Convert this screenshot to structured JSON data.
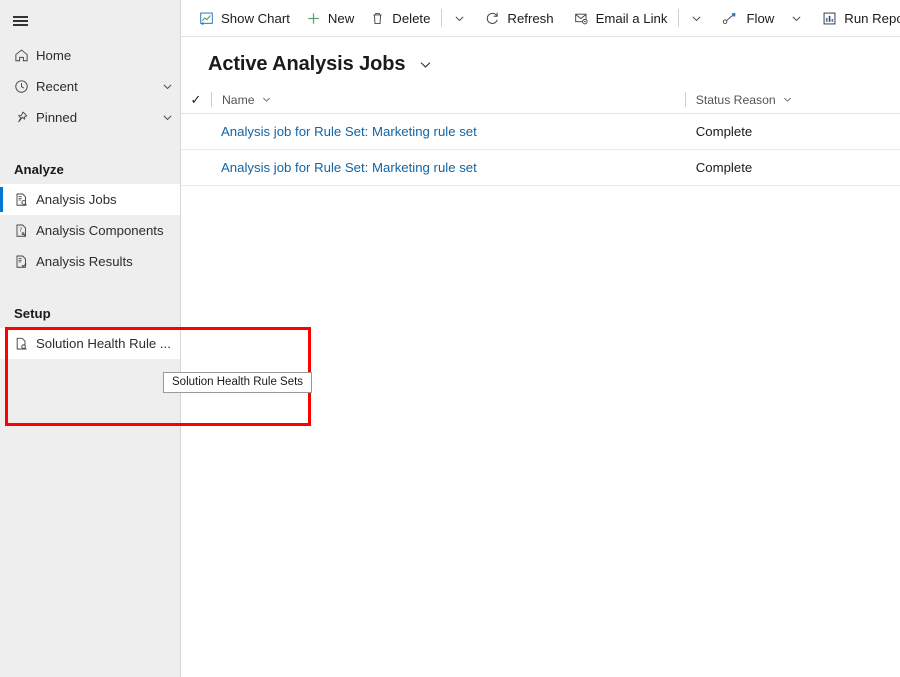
{
  "colors": {
    "accent": "#0078d4",
    "link": "#1264a3",
    "sidebar_bg": "#eeeeee",
    "highlight_box": "#ff0000",
    "new_plus": "#5aa66a",
    "flow_accent": "#3b78c2"
  },
  "sidebar": {
    "hamburger": "site-map-menu-icon",
    "top_items": [
      {
        "label": "Home",
        "icon": "home-icon",
        "chevron": false
      },
      {
        "label": "Recent",
        "icon": "clock-icon",
        "chevron": true
      },
      {
        "label": "Pinned",
        "icon": "pin-icon",
        "chevron": true
      }
    ],
    "groups": [
      {
        "title": "Analyze",
        "items": [
          {
            "label": "Analysis Jobs",
            "icon": "document-search-icon",
            "selected": true
          },
          {
            "label": "Analysis Components",
            "icon": "document-question-icon",
            "selected": false
          },
          {
            "label": "Analysis Results",
            "icon": "document-check-icon",
            "selected": false
          }
        ]
      },
      {
        "title": "Setup",
        "items": [
          {
            "label": "Solution Health Rule ...",
            "icon": "document-search-icon",
            "selected": false
          }
        ]
      }
    ],
    "tooltip": "Solution Health Rule Sets"
  },
  "command_bar": {
    "buttons": [
      {
        "label": "Show Chart",
        "icon": "show-chart-icon"
      },
      {
        "label": "New",
        "icon": "plus-icon"
      },
      {
        "label": "Delete",
        "icon": "trash-icon"
      },
      {
        "label": "Refresh",
        "icon": "refresh-icon"
      },
      {
        "label": "Email a Link",
        "icon": "email-link-icon"
      },
      {
        "label": "Flow",
        "icon": "flow-icon"
      },
      {
        "label": "Run Report",
        "icon": "run-report-icon"
      }
    ]
  },
  "page": {
    "title": "Active Analysis Jobs",
    "title_chevron": "chevron-down-icon"
  },
  "grid": {
    "select_all": "✓",
    "columns": [
      {
        "key": "name",
        "label": "Name"
      },
      {
        "key": "status_reason",
        "label": "Status Reason"
      }
    ],
    "rows": [
      {
        "name": "Analysis job for Rule Set: Marketing rule set",
        "status_reason": "Complete"
      },
      {
        "name": "Analysis job for Rule Set: Marketing rule set",
        "status_reason": "Complete"
      }
    ]
  }
}
